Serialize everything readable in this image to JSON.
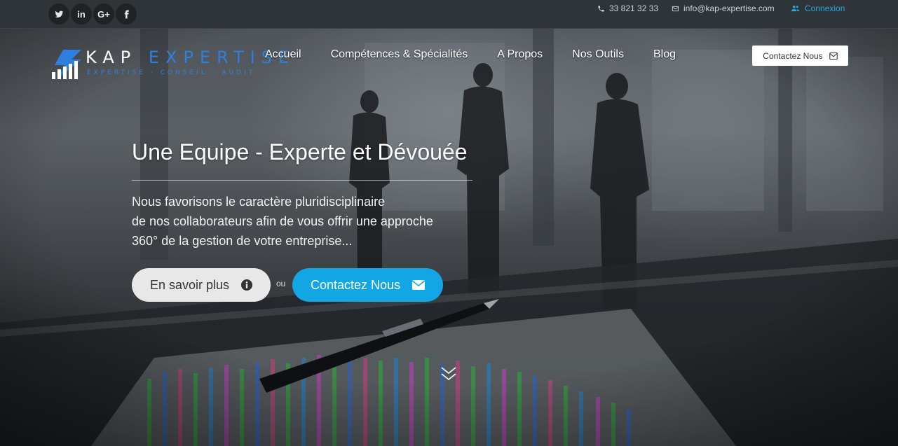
{
  "topbar": {
    "social": [
      {
        "name": "twitter",
        "icon": "twitter-icon"
      },
      {
        "name": "linkedin",
        "icon": "linkedin-icon",
        "glyph": "in"
      },
      {
        "name": "google-plus",
        "icon": "google-plus-icon",
        "glyph": "G+"
      },
      {
        "name": "facebook",
        "icon": "facebook-icon"
      }
    ],
    "phone": "33 821 32 33",
    "email": "info@kap-expertise.com",
    "login": "Connexion"
  },
  "logo": {
    "name_first": "KAP ",
    "name_second": "EXPERTISE",
    "tagline": "EXPERTISE · CONSEIL · AUDIT"
  },
  "nav": {
    "items": [
      "Accueil",
      "Compétences & Spécialités",
      "A Propos",
      "Nos Outils",
      "Blog"
    ],
    "contact_label": "Contactez Nous"
  },
  "hero": {
    "headline": "Une Equipe - Experte et Dévouée",
    "lead_lines": [
      "Nous favorisons le caractère pluridisciplinaire",
      "de nos collaborateurs afin de vous offrir une approche",
      "360° de la gestion de votre entreprise..."
    ],
    "more_label": "En savoir plus",
    "or_label": "ou",
    "contact_label": "Contactez Nous"
  },
  "colors": {
    "accent": "#12a6e4",
    "brand_blue": "#2f7fe0",
    "topbar": "#2f3438"
  }
}
